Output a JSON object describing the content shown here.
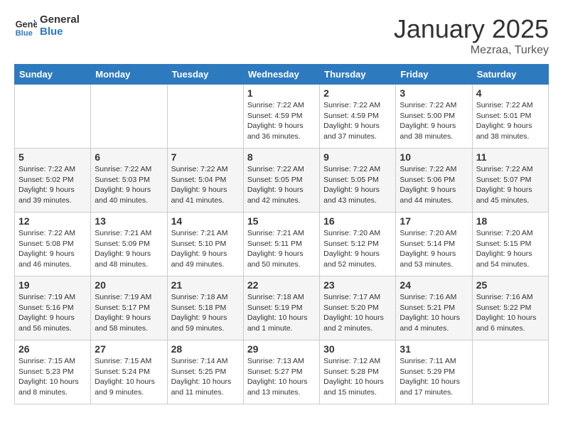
{
  "header": {
    "logo_line1": "General",
    "logo_line2": "Blue",
    "title": "January 2025",
    "subtitle": "Mezraa, Turkey"
  },
  "days_of_week": [
    "Sunday",
    "Monday",
    "Tuesday",
    "Wednesday",
    "Thursday",
    "Friday",
    "Saturday"
  ],
  "weeks": [
    [
      {
        "num": "",
        "info": ""
      },
      {
        "num": "",
        "info": ""
      },
      {
        "num": "",
        "info": ""
      },
      {
        "num": "1",
        "info": "Sunrise: 7:22 AM\nSunset: 4:59 PM\nDaylight: 9 hours and 36 minutes."
      },
      {
        "num": "2",
        "info": "Sunrise: 7:22 AM\nSunset: 4:59 PM\nDaylight: 9 hours and 37 minutes."
      },
      {
        "num": "3",
        "info": "Sunrise: 7:22 AM\nSunset: 5:00 PM\nDaylight: 9 hours and 38 minutes."
      },
      {
        "num": "4",
        "info": "Sunrise: 7:22 AM\nSunset: 5:01 PM\nDaylight: 9 hours and 38 minutes."
      }
    ],
    [
      {
        "num": "5",
        "info": "Sunrise: 7:22 AM\nSunset: 5:02 PM\nDaylight: 9 hours and 39 minutes."
      },
      {
        "num": "6",
        "info": "Sunrise: 7:22 AM\nSunset: 5:03 PM\nDaylight: 9 hours and 40 minutes."
      },
      {
        "num": "7",
        "info": "Sunrise: 7:22 AM\nSunset: 5:04 PM\nDaylight: 9 hours and 41 minutes."
      },
      {
        "num": "8",
        "info": "Sunrise: 7:22 AM\nSunset: 5:05 PM\nDaylight: 9 hours and 42 minutes."
      },
      {
        "num": "9",
        "info": "Sunrise: 7:22 AM\nSunset: 5:05 PM\nDaylight: 9 hours and 43 minutes."
      },
      {
        "num": "10",
        "info": "Sunrise: 7:22 AM\nSunset: 5:06 PM\nDaylight: 9 hours and 44 minutes."
      },
      {
        "num": "11",
        "info": "Sunrise: 7:22 AM\nSunset: 5:07 PM\nDaylight: 9 hours and 45 minutes."
      }
    ],
    [
      {
        "num": "12",
        "info": "Sunrise: 7:22 AM\nSunset: 5:08 PM\nDaylight: 9 hours and 46 minutes."
      },
      {
        "num": "13",
        "info": "Sunrise: 7:21 AM\nSunset: 5:09 PM\nDaylight: 9 hours and 48 minutes."
      },
      {
        "num": "14",
        "info": "Sunrise: 7:21 AM\nSunset: 5:10 PM\nDaylight: 9 hours and 49 minutes."
      },
      {
        "num": "15",
        "info": "Sunrise: 7:21 AM\nSunset: 5:11 PM\nDaylight: 9 hours and 50 minutes."
      },
      {
        "num": "16",
        "info": "Sunrise: 7:20 AM\nSunset: 5:12 PM\nDaylight: 9 hours and 52 minutes."
      },
      {
        "num": "17",
        "info": "Sunrise: 7:20 AM\nSunset: 5:14 PM\nDaylight: 9 hours and 53 minutes."
      },
      {
        "num": "18",
        "info": "Sunrise: 7:20 AM\nSunset: 5:15 PM\nDaylight: 9 hours and 54 minutes."
      }
    ],
    [
      {
        "num": "19",
        "info": "Sunrise: 7:19 AM\nSunset: 5:16 PM\nDaylight: 9 hours and 56 minutes."
      },
      {
        "num": "20",
        "info": "Sunrise: 7:19 AM\nSunset: 5:17 PM\nDaylight: 9 hours and 58 minutes."
      },
      {
        "num": "21",
        "info": "Sunrise: 7:18 AM\nSunset: 5:18 PM\nDaylight: 9 hours and 59 minutes."
      },
      {
        "num": "22",
        "info": "Sunrise: 7:18 AM\nSunset: 5:19 PM\nDaylight: 10 hours and 1 minute."
      },
      {
        "num": "23",
        "info": "Sunrise: 7:17 AM\nSunset: 5:20 PM\nDaylight: 10 hours and 2 minutes."
      },
      {
        "num": "24",
        "info": "Sunrise: 7:16 AM\nSunset: 5:21 PM\nDaylight: 10 hours and 4 minutes."
      },
      {
        "num": "25",
        "info": "Sunrise: 7:16 AM\nSunset: 5:22 PM\nDaylight: 10 hours and 6 minutes."
      }
    ],
    [
      {
        "num": "26",
        "info": "Sunrise: 7:15 AM\nSunset: 5:23 PM\nDaylight: 10 hours and 8 minutes."
      },
      {
        "num": "27",
        "info": "Sunrise: 7:15 AM\nSunset: 5:24 PM\nDaylight: 10 hours and 9 minutes."
      },
      {
        "num": "28",
        "info": "Sunrise: 7:14 AM\nSunset: 5:25 PM\nDaylight: 10 hours and 11 minutes."
      },
      {
        "num": "29",
        "info": "Sunrise: 7:13 AM\nSunset: 5:27 PM\nDaylight: 10 hours and 13 minutes."
      },
      {
        "num": "30",
        "info": "Sunrise: 7:12 AM\nSunset: 5:28 PM\nDaylight: 10 hours and 15 minutes."
      },
      {
        "num": "31",
        "info": "Sunrise: 7:11 AM\nSunset: 5:29 PM\nDaylight: 10 hours and 17 minutes."
      },
      {
        "num": "",
        "info": ""
      }
    ]
  ]
}
